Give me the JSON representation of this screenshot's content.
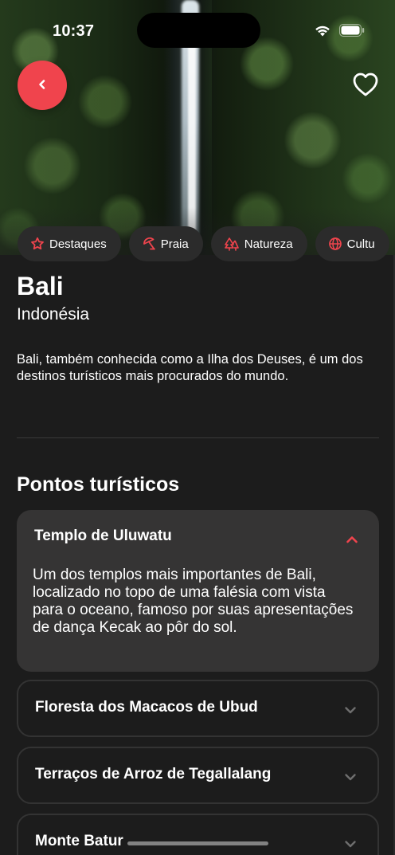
{
  "status_bar": {
    "time": "10:37"
  },
  "colors": {
    "accent": "#f0444d",
    "background": "#1c1c1c",
    "card": "#353434",
    "chip": "#2b2b2b"
  },
  "header": {
    "back_icon": "chevron-left-icon",
    "favorite_icon": "heart-outline-icon"
  },
  "categories": [
    {
      "label": "Destaques",
      "icon": "star-icon"
    },
    {
      "label": "Praia",
      "icon": "beach-umbrella-icon"
    },
    {
      "label": "Natureza",
      "icon": "trees-icon"
    },
    {
      "label": "Cultu",
      "icon": "globe-icon"
    }
  ],
  "place": {
    "title": "Bali",
    "country": "Indonésia",
    "description": "Bali, também conhecida como a Ilha dos Deuses, é um dos destinos turísticos mais procurados do mundo."
  },
  "attractions": {
    "section_title": "Pontos turísticos",
    "items": [
      {
        "title": "Templo de Uluwatu",
        "expanded": true,
        "description": "Um dos templos mais importantes de Bali, localizado no topo de uma falésia com vista para o oceano, famoso por suas apresentações de dança Kecak ao pôr do sol."
      },
      {
        "title": "Floresta dos Macacos de Ubud",
        "expanded": false
      },
      {
        "title": "Terraços de Arroz de Tegallalang",
        "expanded": false
      },
      {
        "title": "Monte Batur",
        "expanded": false
      }
    ]
  }
}
